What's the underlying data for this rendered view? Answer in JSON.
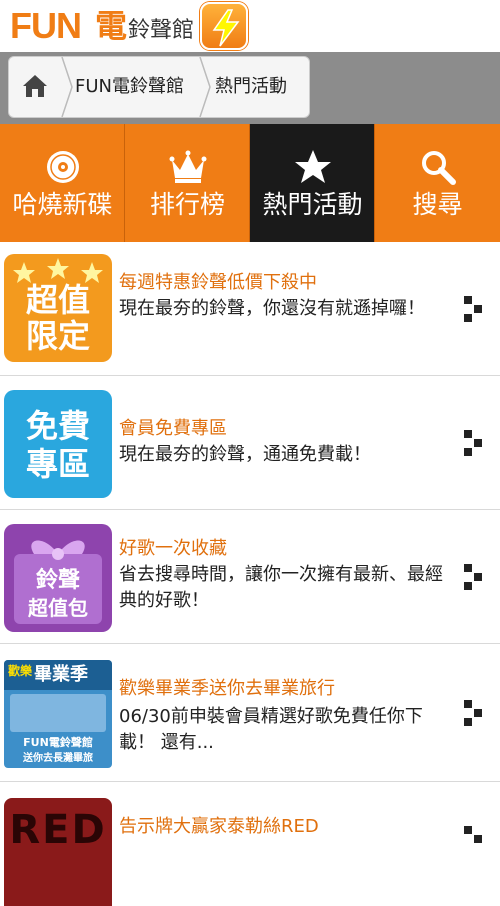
{
  "header": {
    "logo_fun": "FUN",
    "logo_den": "電",
    "logo_rest": "鈴聲館"
  },
  "breadcrumb": {
    "items": [
      "FUN電鈴聲館",
      "熱門活動"
    ]
  },
  "nav": {
    "items": [
      {
        "label": "哈燒新碟",
        "icon": "disc-icon"
      },
      {
        "label": "排行榜",
        "icon": "crown-icon"
      },
      {
        "label": "熱門活動",
        "icon": "star-icon",
        "active": true
      },
      {
        "label": "搜尋",
        "icon": "search-icon"
      }
    ]
  },
  "list": {
    "items": [
      {
        "title": "每週特惠鈴聲低價下殺中",
        "desc": "現在最夯的鈴聲，你還沒有就遜掉囉！",
        "thumb_text": [
          "超值",
          "限定"
        ],
        "thumb_color": "#f39a1e"
      },
      {
        "title": "會員免費專區",
        "desc": "現在最夯的鈴聲，通通免費載！",
        "thumb_text": [
          "免費",
          "專區"
        ],
        "thumb_color": "#2aa7de"
      },
      {
        "title": "好歌一次收藏",
        "desc": "省去搜尋時間，讓你一次擁有最新、最經典的好歌！",
        "thumb_text": [
          "鈴聲",
          "超值包"
        ],
        "thumb_color": "#8e44ad"
      },
      {
        "title": "歡樂畢業季送你去畢業旅行",
        "desc": "06/30前申裝會員精選好歌免費任你下載！ 還有...",
        "thumb_text": [
          "歡樂",
          "畢業季",
          "FUN電鈴聲館",
          "送你去長灘畢旅"
        ],
        "thumb_color": "#3d8fc9"
      },
      {
        "title": "告示牌大贏家泰勒絲RED",
        "desc": "",
        "thumb_text": [
          "RED"
        ],
        "thumb_color": "#8a1a1a"
      }
    ]
  },
  "colors": {
    "accent": "#f07d15",
    "active_tab": "#1a1a1a",
    "title_text": "#e0700e"
  }
}
